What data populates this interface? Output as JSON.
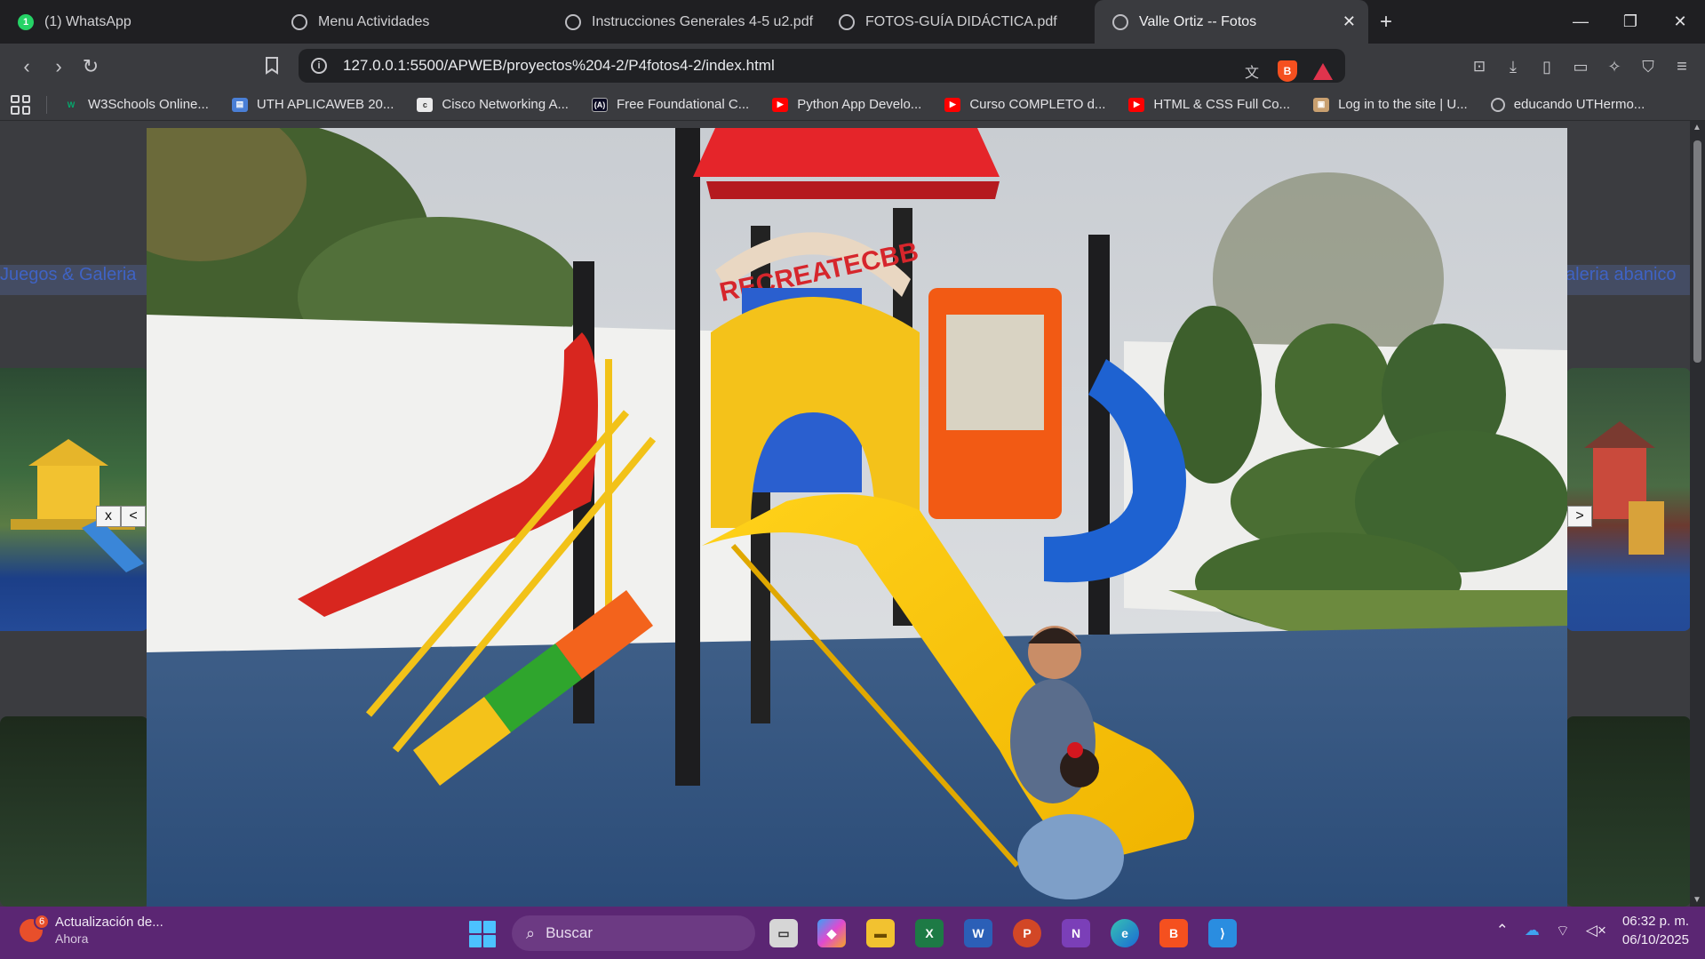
{
  "browser": {
    "tabs": [
      {
        "title": "(1) WhatsApp",
        "icon": "whatsapp-icon",
        "active": false
      },
      {
        "title": "Menu Actividades",
        "icon": "globe-icon",
        "active": false
      },
      {
        "title": "Instrucciones Generales 4-5 u2.pdf",
        "icon": "globe-icon",
        "active": false
      },
      {
        "title": "FOTOS-GUÍA DIDÁCTICA.pdf",
        "icon": "globe-icon",
        "active": false
      },
      {
        "title": "Valle Ortiz -- Fotos",
        "icon": "globe-icon",
        "active": true
      }
    ],
    "url": "127.0.0.1:5500/APWEB/proyectos%204-2/P4fotos4-2/index.html",
    "bookmarks": [
      {
        "label": "W3Schools Online...",
        "icon": "w3schools-icon",
        "color": "#04aa6d"
      },
      {
        "label": "UTH APLICAWEB 20...",
        "icon": "doc-icon",
        "color": "#4a7fd6"
      },
      {
        "label": "Cisco Networking A...",
        "icon": "cisco-icon",
        "color": "#e9e9ea"
      },
      {
        "label": "Free Foundational C...",
        "icon": "freecodecamp-icon",
        "color": "#0a0a23"
      },
      {
        "label": "Python App Develo...",
        "icon": "youtube-icon",
        "color": "#ff0000"
      },
      {
        "label": "Curso COMPLETO d...",
        "icon": "youtube-icon",
        "color": "#ff0000"
      },
      {
        "label": "HTML & CSS Full Co...",
        "icon": "youtube-icon",
        "color": "#ff0000"
      },
      {
        "label": "Log in to the site | U...",
        "icon": "moodle-icon",
        "color": "#c9a070"
      },
      {
        "label": "educando UTHermo...",
        "icon": "globe-icon",
        "color": "#bdbdc2"
      }
    ]
  },
  "page": {
    "left_label": "Juegos & Galeria",
    "right_label": "aleria abanico",
    "close_button": "x",
    "prev_button": "<",
    "next_button": ">",
    "photo_sign": "RECREATECBB"
  },
  "taskbar": {
    "notification_title": "Actualización de...",
    "notification_sub": "Ahora",
    "notification_count": "6",
    "search_placeholder": "Buscar",
    "time": "06:32 p. m.",
    "date": "06/10/2025"
  },
  "colors": {
    "taskbar": "#5b2673",
    "tab_active": "#3a3b3f",
    "accent_blue": "#4cc2ff"
  }
}
